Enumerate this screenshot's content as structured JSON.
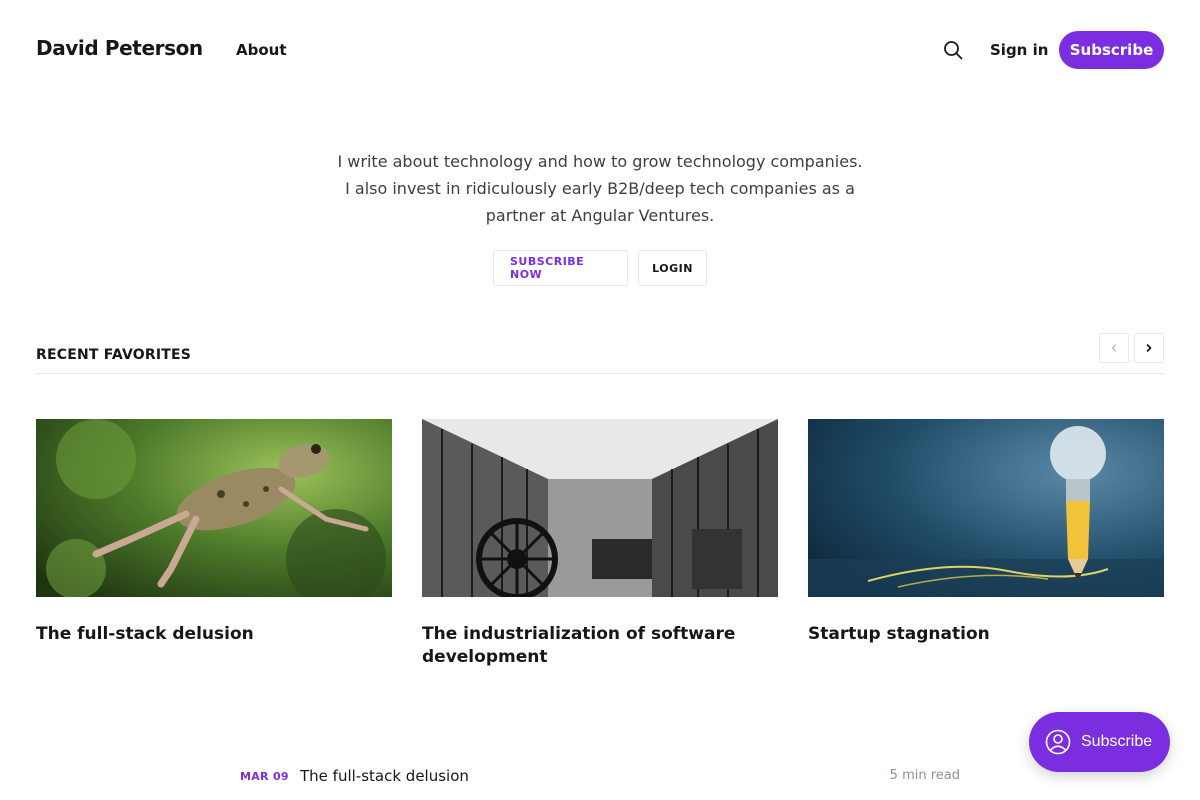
{
  "header": {
    "brand": "David Peterson",
    "nav_about": "About",
    "signin": "Sign in",
    "subscribe": "Subscribe"
  },
  "hero": {
    "line1": "I write about technology and how to grow technology companies.",
    "line2": "I also invest in ridiculously early B2B/deep tech companies as a",
    "line3": "partner at Angular Ventures.",
    "subscribe_now": "SUBSCRIBE NOW",
    "login": "LOGIN"
  },
  "section": {
    "title": "RECENT FAVORITES"
  },
  "cards": [
    {
      "title": "The full-stack delusion"
    },
    {
      "title": "The industrialization of software development"
    },
    {
      "title": "Startup stagnation"
    }
  ],
  "list": [
    {
      "date": "MAR 09",
      "title": "The full-stack delusion",
      "read": "5 min read"
    }
  ],
  "floating": {
    "label": "Subscribe"
  },
  "colors": {
    "accent": "#7a2ee0",
    "text": "#15171a",
    "muted": "#8e9398"
  },
  "icons": {
    "search": "search-icon",
    "prev": "chevron-left-icon",
    "next": "chevron-right-icon",
    "user": "user-circle-icon"
  }
}
